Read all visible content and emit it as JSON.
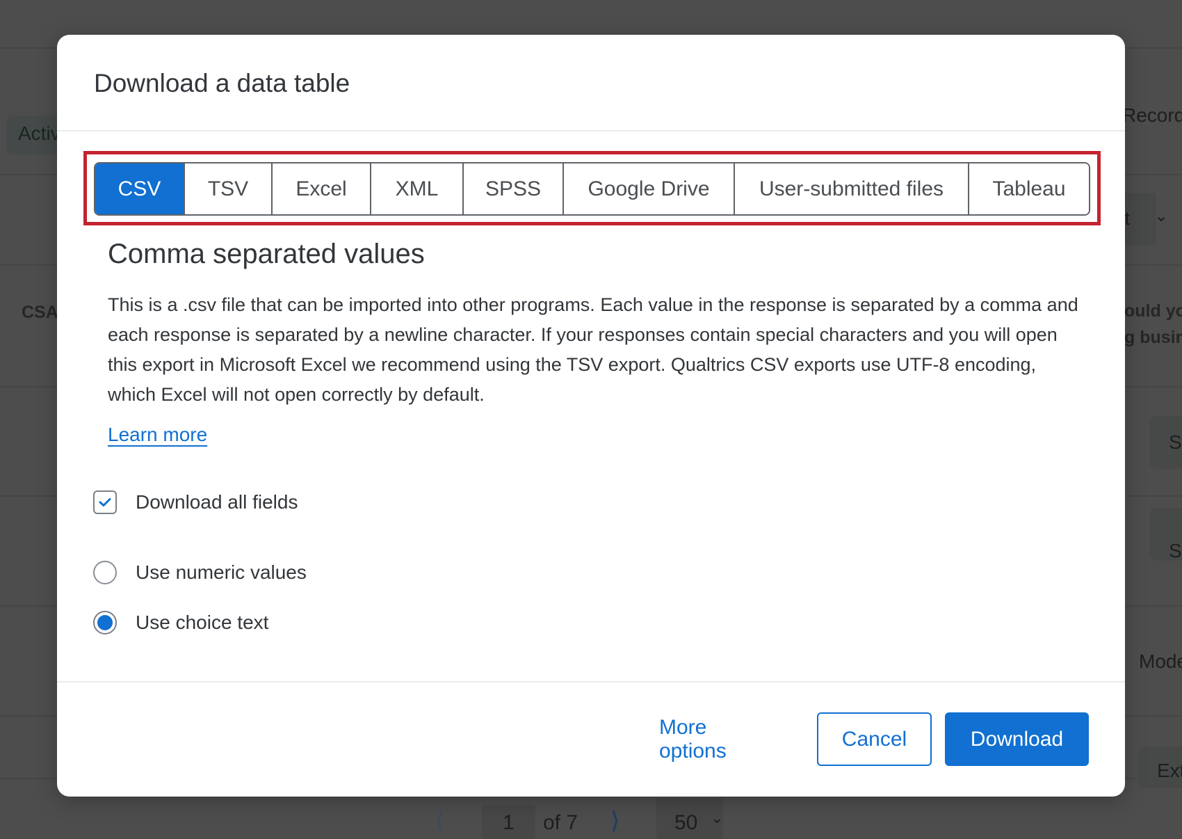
{
  "background": {
    "texts": {
      "status_badge": "Activ",
      "record_label": "Record",
      "export_dropdown": "rt",
      "csat_label": "CSA",
      "question_line1": "ould yo",
      "question_line2": "g busin",
      "side_button_1": "S",
      "side_button_2": "S",
      "mode_label": "Mode",
      "ext_label": "Ext"
    },
    "pagination": {
      "current_page": "1",
      "of_label": "of 7",
      "page_size": "50"
    }
  },
  "modal": {
    "title": "Download a data table",
    "tabs": [
      {
        "label": "CSV",
        "active": true
      },
      {
        "label": "TSV",
        "active": false
      },
      {
        "label": "Excel",
        "active": false
      },
      {
        "label": "XML",
        "active": false
      },
      {
        "label": "SPSS",
        "active": false
      },
      {
        "label": "Google Drive",
        "active": false
      },
      {
        "label": "User-submitted files",
        "active": false
      },
      {
        "label": "Tableau",
        "active": false
      }
    ],
    "section_title": "Comma separated values",
    "description": "This is a .csv file that can be imported into other programs. Each value in the response is separated by a comma and each response is separated by a newline character. If your responses contain special characters and you will open this export in Microsoft Excel we recommend using the TSV export. Qualtrics CSV exports use UTF-8 encoding, which Excel will not open correctly by default.",
    "learn_more": "Learn more",
    "options": {
      "download_all_fields": {
        "label": "Download all fields",
        "checked": true
      },
      "value_format": [
        {
          "label": "Use numeric values",
          "selected": false
        },
        {
          "label": "Use choice text",
          "selected": true
        }
      ]
    },
    "footer": {
      "more_options": "More options",
      "cancel": "Cancel",
      "download": "Download"
    }
  },
  "colors": {
    "accent": "#1170d1",
    "highlight_border": "#c4232f",
    "text": "#32363a",
    "overlay_background": "#4d4d4d"
  }
}
